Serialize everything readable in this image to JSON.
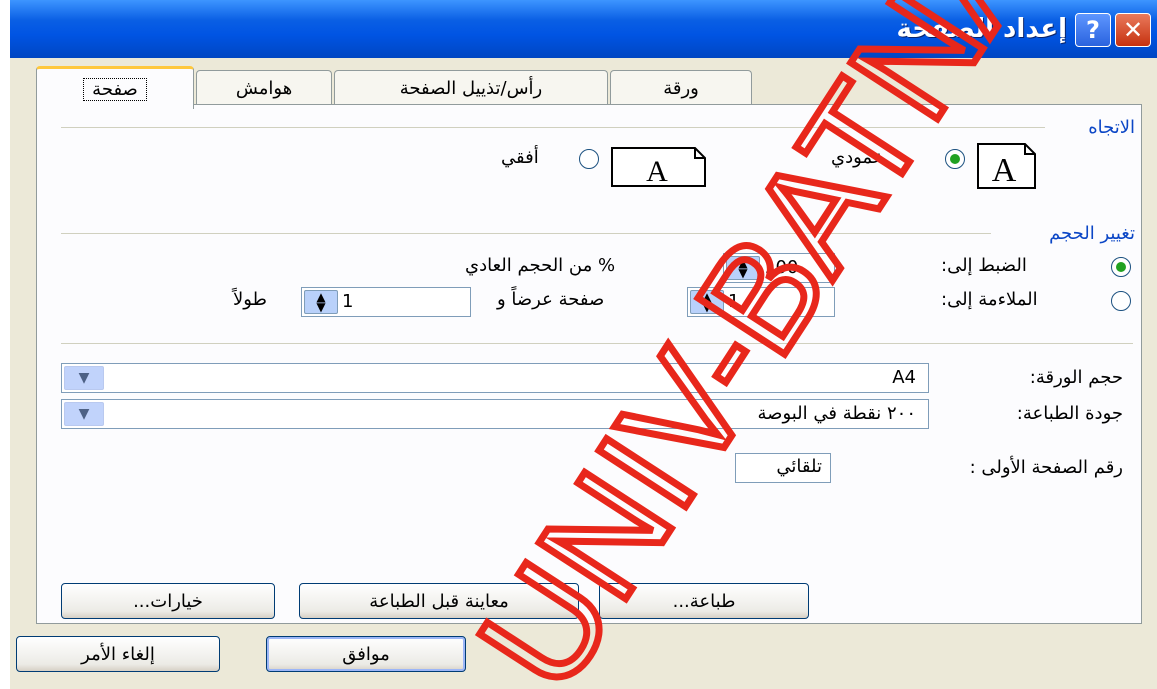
{
  "window": {
    "title": "إعداد الصفحة",
    "help_glyph": "?",
    "close_glyph": "✕",
    "titlebar_color": "#0054e3"
  },
  "tabs": [
    {
      "label": "صفحة",
      "active": true
    },
    {
      "label": "هوامش",
      "active": false
    },
    {
      "label": "رأس/تذييل الصفحة",
      "active": false
    },
    {
      "label": "ورقة",
      "active": false
    }
  ],
  "orientation": {
    "group_label": "الاتجاه",
    "portrait_label": "عمودي",
    "landscape_label": "أفقي",
    "page_glyph": "A",
    "selected": "portrait"
  },
  "scaling": {
    "group_label": "تغيير الحجم",
    "adjust_label": "الضبط إلى:",
    "adjust_value": "100",
    "adjust_suffix": "% من الحجم العادي",
    "fit_label": "الملاءمة إلى:",
    "fit_wide_value": "1",
    "fit_wide_suffix": "صفحة عرضاً و",
    "fit_tall_value": "1",
    "fit_tall_suffix": "طولاً",
    "selected": "adjust"
  },
  "paper_size": {
    "label": "حجم الورقة:",
    "value": "A4"
  },
  "print_quality": {
    "label": "جودة الطباعة:",
    "value": "٢٠٠ نقطة في البوصة"
  },
  "first_page_number": {
    "label": "رقم الصفحة الأولى :",
    "value": "تلقائي"
  },
  "panel_buttons": {
    "print": "طباعة...",
    "print_preview": "معاينة قبل الطباعة",
    "options": "خيارات..."
  },
  "dialog_buttons": {
    "ok": "موافق",
    "cancel": "إلغاء الأمر"
  },
  "watermark": {
    "text": "UNIV-BATNA",
    "color": "#e8271b"
  },
  "accent_label_color": "#0b46c6"
}
